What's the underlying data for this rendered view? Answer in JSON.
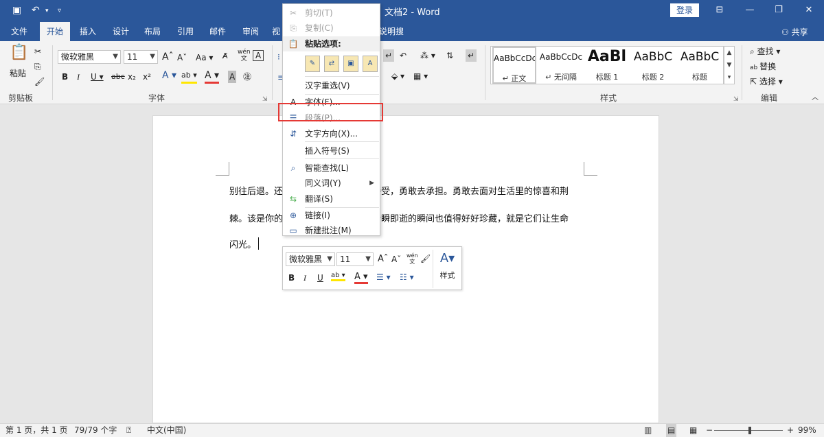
{
  "app": {
    "doc_title": "文档2 - Word",
    "login_label": "登录",
    "share_label": "共享",
    "colors": {
      "brand": "#2b579a",
      "highlight": "#e53935"
    }
  },
  "quick_access": {
    "icons": [
      "save-icon",
      "undo-icon",
      "customize-icon"
    ]
  },
  "tabs": [
    {
      "label": "文件"
    },
    {
      "label": "开始"
    },
    {
      "label": "插入"
    },
    {
      "label": "设计"
    },
    {
      "label": "布局"
    },
    {
      "label": "引用"
    },
    {
      "label": "邮件"
    },
    {
      "label": "审阅"
    },
    {
      "label": "视"
    },
    {
      "label": "说明搜索"
    }
  ],
  "ribbon": {
    "clipboard": {
      "paste_label": "粘贴",
      "group_label": "剪贴板"
    },
    "font": {
      "name": "微软雅黑",
      "size": "11",
      "group_label": "字体",
      "bold": "B",
      "italic": "I",
      "underline": "U",
      "strike": "abc",
      "sub": "x₂",
      "sup": "x²",
      "grow": "A",
      "shrink": "A",
      "case": "Aa",
      "wen": "wén\n文",
      "boxA": "A"
    },
    "styles": {
      "group_label": "样式",
      "items": [
        {
          "sample": "AaBbCcDc",
          "name": "↵ 正文"
        },
        {
          "sample": "AaBbCcDc",
          "name": "↵ 无间隔"
        },
        {
          "sample": "AaBl",
          "name": "标题 1"
        },
        {
          "sample": "AaBbC",
          "name": "标题 2"
        },
        {
          "sample": "AaBbC",
          "name": "标题"
        }
      ]
    },
    "editing": {
      "find": "查找",
      "replace": "替换",
      "select": "选择",
      "group_label": "编辑"
    }
  },
  "document": {
    "lines": [
      "别往后退。还　　　　　　　　　　接受，勇敢去承担。勇敢去面对生活里的惊喜和荆",
      "棘。该是你的　　　　　　　　　　转瞬即逝的瞬间也值得好好珍藏，就是它们让生命",
      "闪光。"
    ]
  },
  "context_menu": {
    "cut": "剪切(T)",
    "copy": "复制(C)",
    "paste_options": "粘贴选项:",
    "hanzi_reselect": "汉字重选(V)",
    "font": "字体(F)...",
    "paragraph": "段落(P)...",
    "text_direction": "文字方向(X)...",
    "insert_symbol": "插入符号(S)",
    "smart_lookup": "智能查找(L)",
    "synonyms": "同义词(Y)",
    "translate": "翻译(S)",
    "link": "链接(I)",
    "new_comment": "新建批注(M)"
  },
  "mini_toolbar": {
    "font_name": "微软雅黑",
    "font_size": "11",
    "styles_label": "样式"
  },
  "status_bar": {
    "page": "第 1 页，共 1 页",
    "words": "79/79 个字",
    "language": "中文(中国)",
    "zoom": "99%"
  }
}
